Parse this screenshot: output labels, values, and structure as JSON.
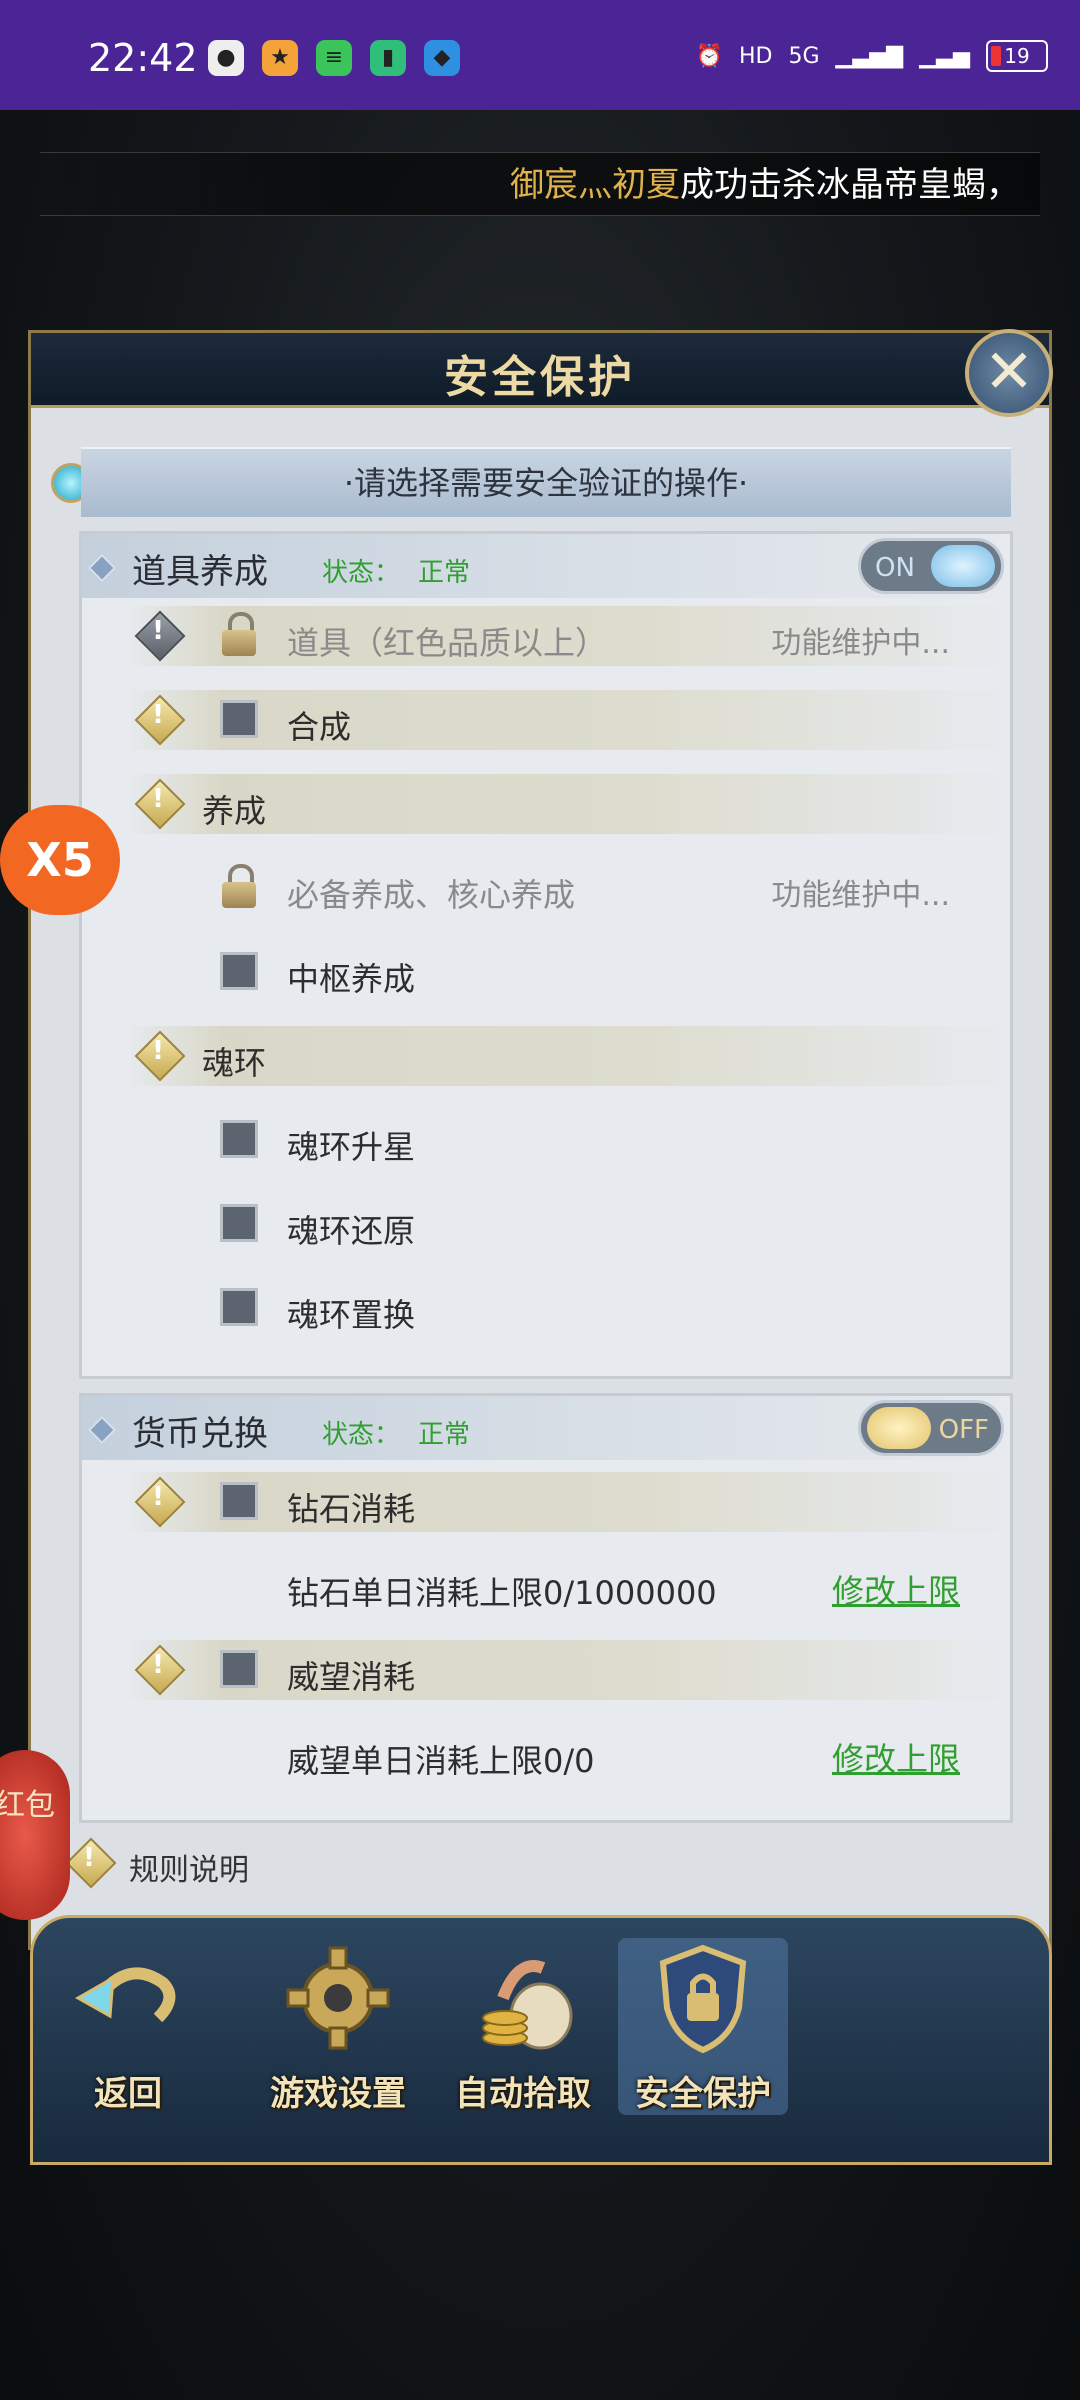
{
  "status_bar": {
    "time": "22:42",
    "apps": [
      "wechat",
      "app2",
      "app3",
      "app4",
      "app5"
    ],
    "network_label": "HD",
    "signal_label": "5G",
    "battery": "19",
    "colors": {
      "background": "#4b2596"
    }
  },
  "broadcast": {
    "name": "御宸灬初夏",
    "message": "成功击杀冰晶帝皇蝎，"
  },
  "dialog": {
    "title": "安全保护",
    "close_glyph": "✕",
    "prompt": "·请选择需要安全验证的操作·"
  },
  "item_section": {
    "title": "道具养成",
    "status_label": "状态：",
    "status_value": "正常",
    "toggle_label": "ON",
    "rows": {
      "item_red": "道具（红色品质以上）",
      "item_red_status": "功能维护中...",
      "compose": "合成",
      "cultivate": "养成",
      "core_cultivate": "必备养成、核心养成",
      "core_cultivate_status": "功能维护中...",
      "hub_cultivate": "中枢养成",
      "soul_ring": "魂环",
      "soul_star": "魂环升星",
      "soul_restore": "魂环还原",
      "soul_swap": "魂环置换"
    }
  },
  "currency_section": {
    "title": "货币兑换",
    "status_label": "状态：",
    "status_value": "正常",
    "toggle_label": "OFF",
    "rows": {
      "diamond": "钻石消耗",
      "diamond_limit": "钻石单日消耗上限0/1000000",
      "diamond_modify": "修改上限",
      "prestige": "威望消耗",
      "prestige_limit": "威望单日消耗上限0/0",
      "prestige_modify": "修改上限"
    }
  },
  "rules_label": "规则说明",
  "bottom_nav": {
    "back": "返回",
    "game_settings": "游戏设置",
    "auto_pickup": "自动拾取",
    "security": "安全保护"
  },
  "floating": {
    "x5": "X5",
    "red_packet": "红包"
  }
}
